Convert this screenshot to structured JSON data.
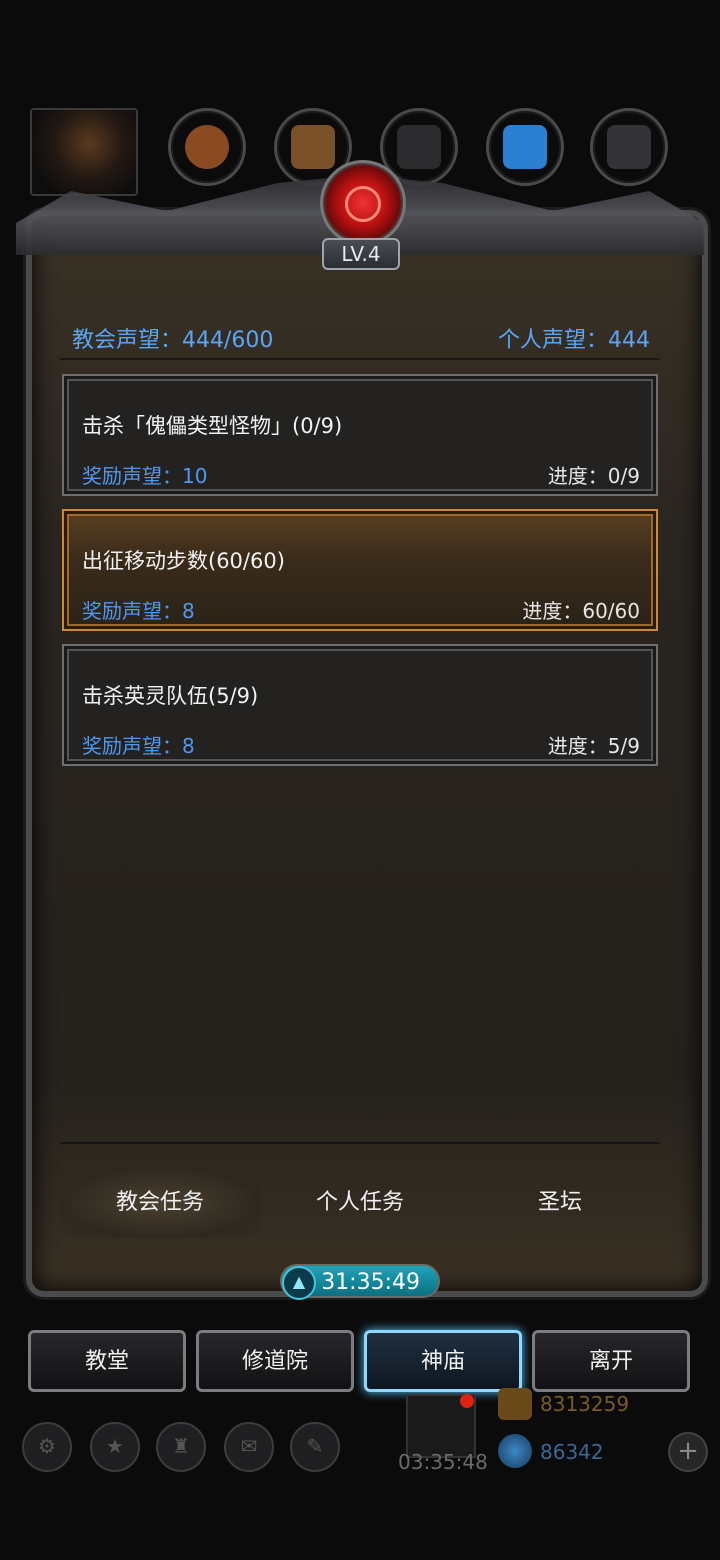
{
  "header": {
    "level": "LV.4"
  },
  "reputation": {
    "church": "教会声望：444/600",
    "personal": "个人声望：444"
  },
  "tasks": [
    {
      "title": "击杀「傀儡类型怪物」(0/9)",
      "reward": "奖励声望：10",
      "progress": "进度：0/9"
    },
    {
      "title": "出征移动步数(60/60)",
      "reward": "奖励声望：8",
      "progress": "进度：60/60"
    },
    {
      "title": "击杀英灵队伍(5/9)",
      "reward": "奖励声望：8",
      "progress": "进度：5/9"
    }
  ],
  "tabs": [
    {
      "label": "教会任务"
    },
    {
      "label": "个人任务"
    },
    {
      "label": "圣坛"
    }
  ],
  "timer": "31:35:49",
  "nav": [
    {
      "label": "教堂"
    },
    {
      "label": "修道院"
    },
    {
      "label": "神庙"
    },
    {
      "label": "离开"
    }
  ],
  "bottom": {
    "gift_timer": "03:35:48",
    "gold": "8313259",
    "gems": "86342"
  },
  "colors": {
    "accent_blue": "#5aa6f5",
    "selected_border": "#c88a3a",
    "timer_cyan": "#1ea4b8"
  }
}
